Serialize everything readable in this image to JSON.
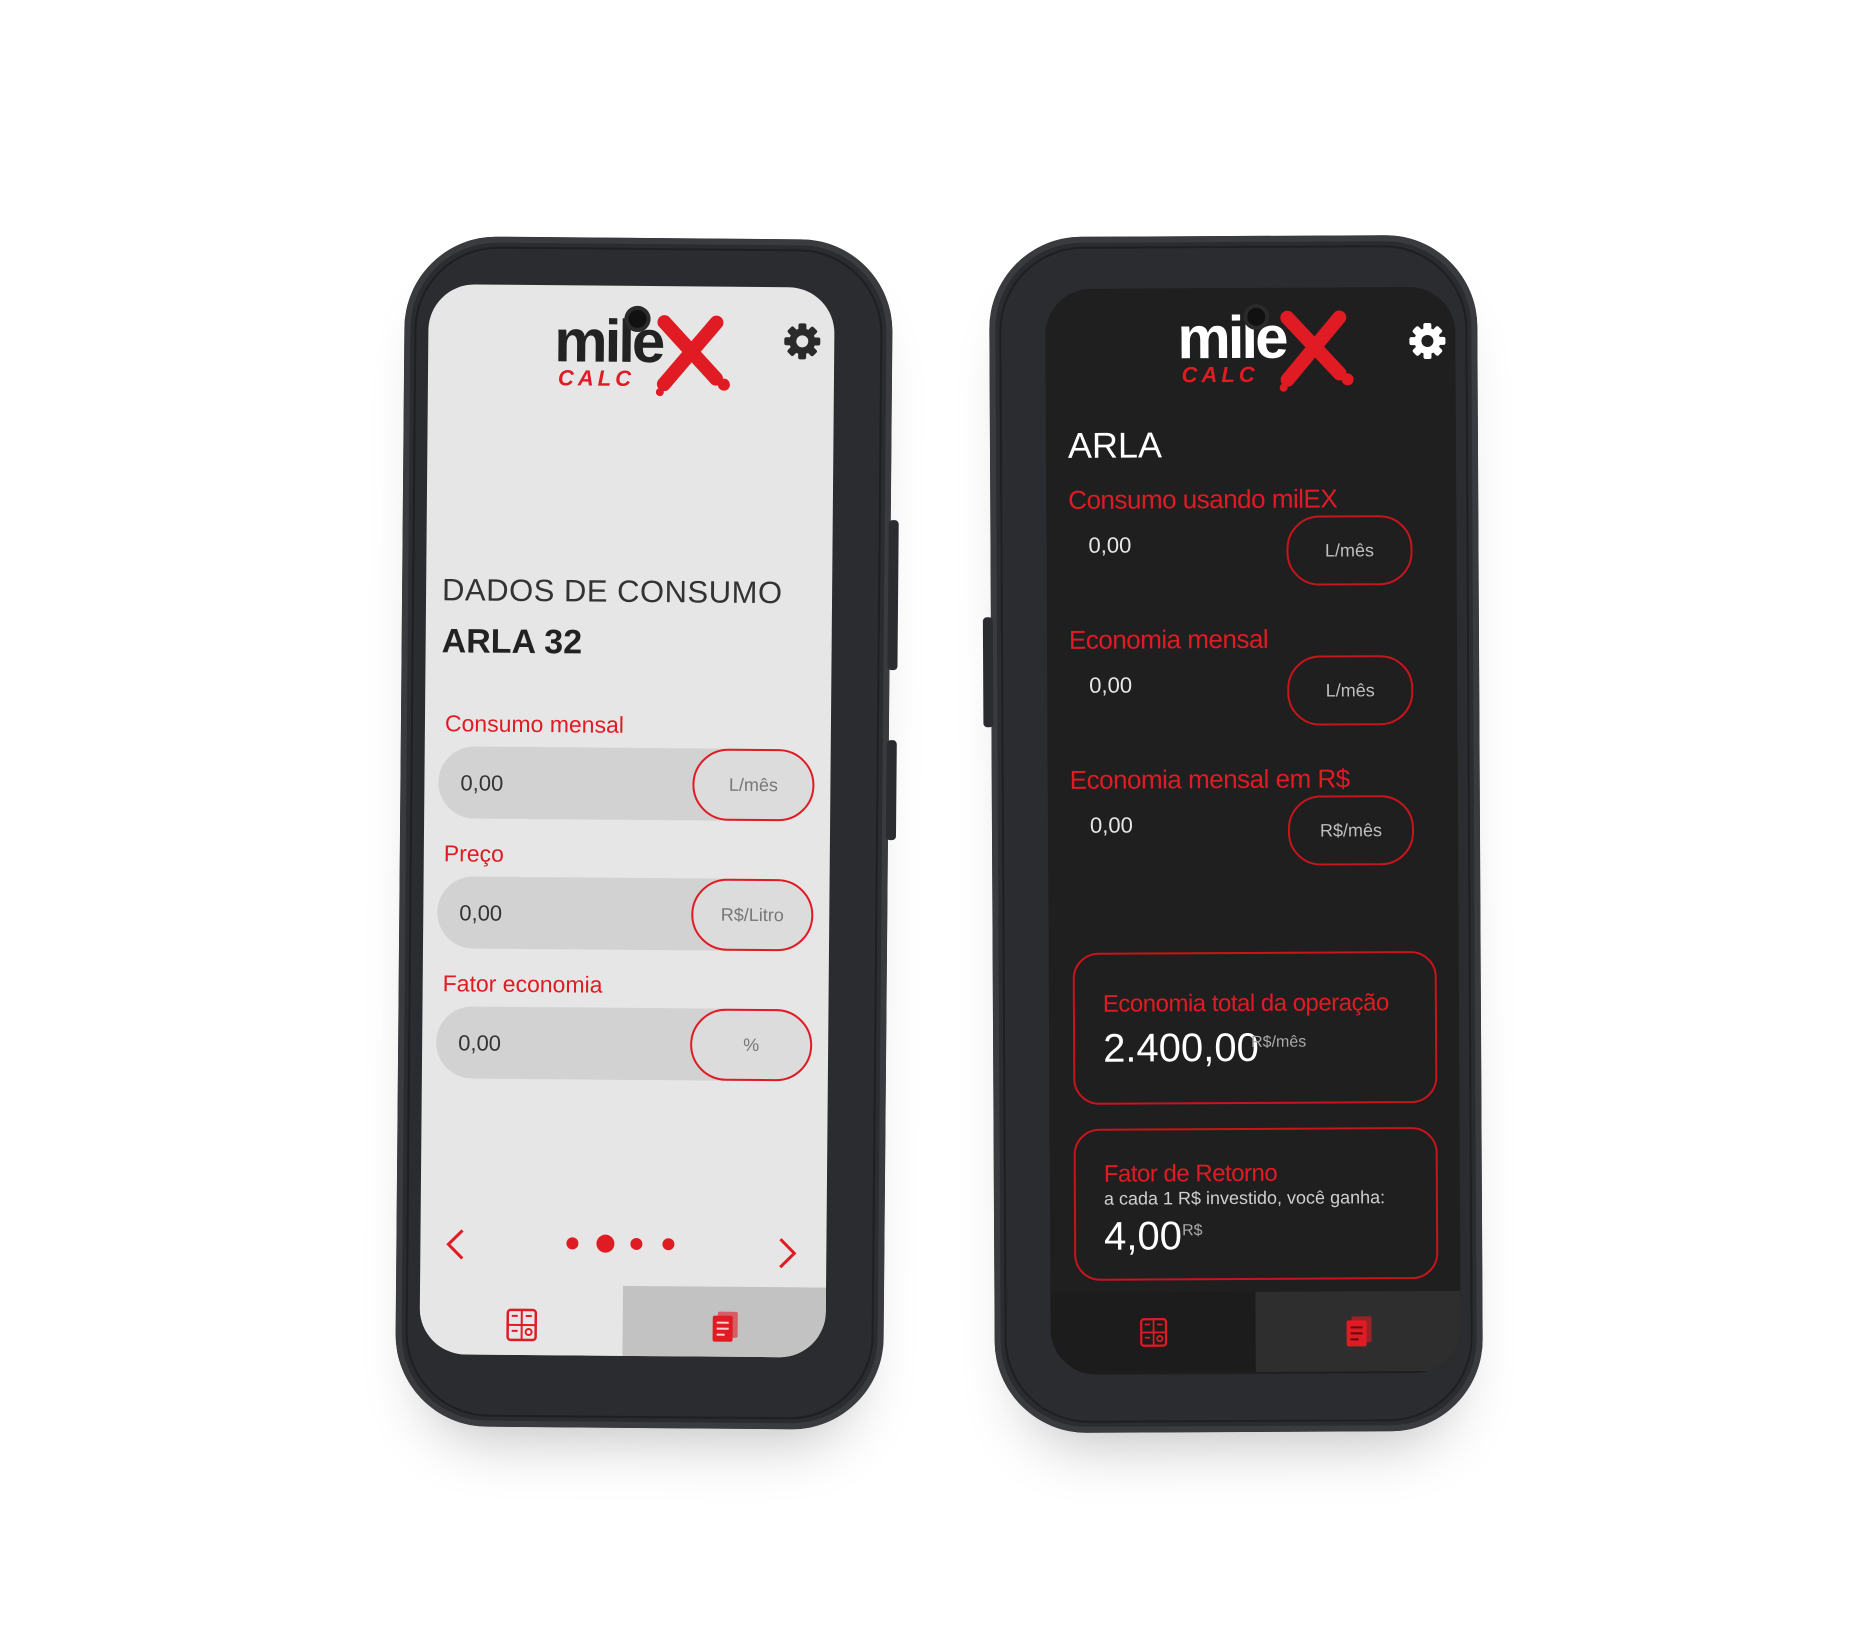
{
  "brand": {
    "logo_word": "mile",
    "logo_sub": "CALC",
    "accent": "#e01b24",
    "light_bg": "#e6e6e6",
    "dark_bg": "#1f1f1f"
  },
  "light_screen": {
    "settings_icon": "gear-icon",
    "heading": "DADOS DE CONSUMO",
    "subheading": "ARLA 32",
    "fields": [
      {
        "label": "Consumo mensal",
        "value": "0,00",
        "unit": "L/mês"
      },
      {
        "label": "Preço",
        "value": "0,00",
        "unit": "R$/Litro"
      },
      {
        "label": "Fator economia",
        "value": "0,00",
        "unit": "%"
      }
    ],
    "pager": {
      "total": 4,
      "active_index": 1
    },
    "tabs": [
      {
        "icon": "calculator-icon",
        "selected": true
      },
      {
        "icon": "report-icon",
        "selected": false
      }
    ]
  },
  "dark_screen": {
    "settings_icon": "gear-icon",
    "title": "ARLA",
    "fields": [
      {
        "label": "Consumo usando milEX",
        "value": "0,00",
        "unit": "L/mês"
      },
      {
        "label": "Economia mensal",
        "value": "0,00",
        "unit": "L/mês"
      },
      {
        "label": "Economia mensal em R$",
        "value": "0,00",
        "unit": "R$/mês"
      }
    ],
    "total_card": {
      "title": "Economia total da operação",
      "value": "2.400,00",
      "unit": "R$/mês"
    },
    "return_card": {
      "title": "Fator de Retorno",
      "subtitle": "a cada 1 R$ investido, você ganha:",
      "value": "4,00",
      "unit": "R$"
    },
    "tabs": [
      {
        "icon": "calculator-icon",
        "selected": false
      },
      {
        "icon": "report-icon",
        "selected": true
      }
    ]
  }
}
